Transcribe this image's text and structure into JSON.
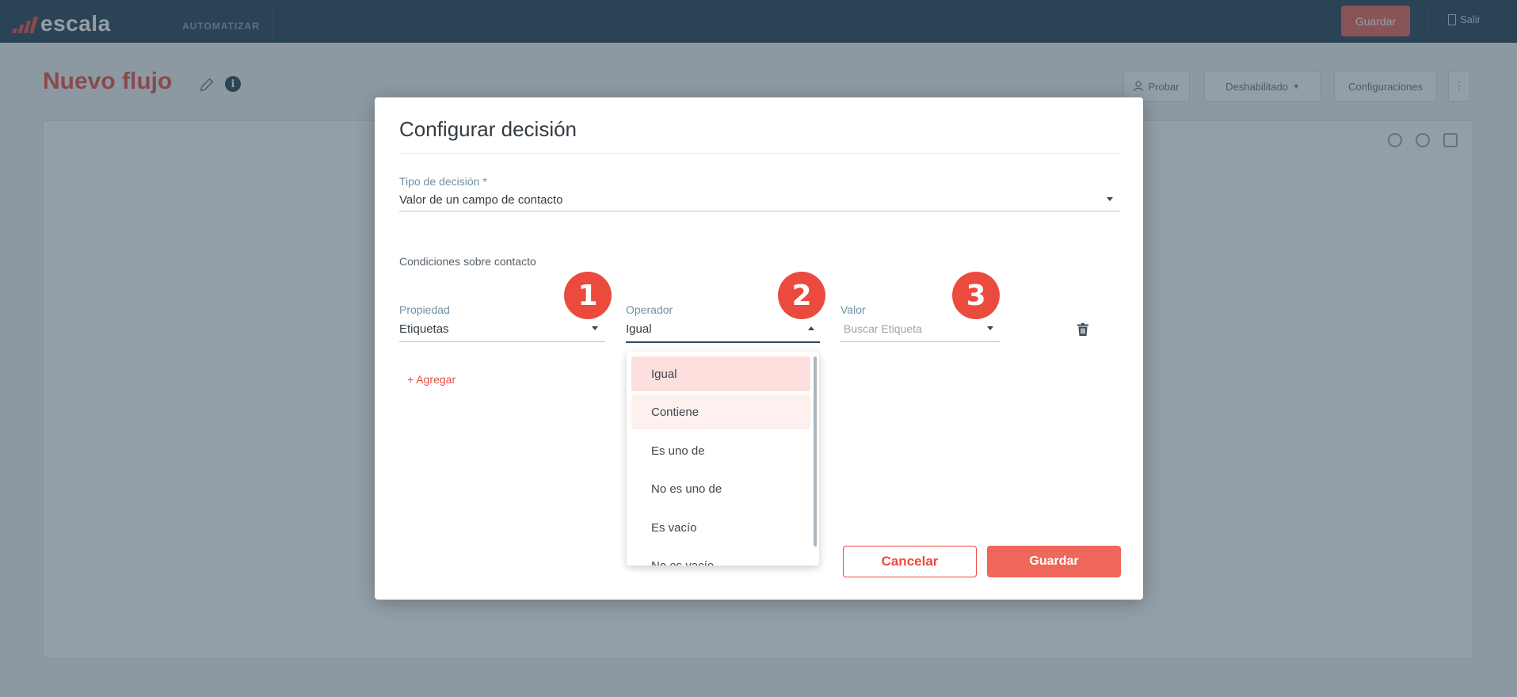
{
  "app": {
    "logo_text": "escala",
    "nav_label": "AUTOMATIZAR",
    "save_label": "Guardar",
    "exit_label": "Salir"
  },
  "page": {
    "title": "Nuevo flujo",
    "toolbar": {
      "test_label": "Probar",
      "status_label": "Deshabilitado",
      "settings_label": "Configuraciones",
      "more_label": "⋮"
    }
  },
  "modal": {
    "title": "Configurar decisión",
    "decision_type": {
      "label": "Tipo de decisión *",
      "value": "Valor de un campo de contacto"
    },
    "conditions_label": "Condiciones sobre contacto",
    "property": {
      "label": "Propiedad",
      "value": "Etiquetas",
      "badge": "1"
    },
    "operator": {
      "label": "Operador",
      "value": "Igual",
      "badge": "2",
      "options": [
        "Igual",
        "Contiene",
        "Es uno de",
        "No es uno de",
        "Es vacío",
        "No es vacío"
      ]
    },
    "valor": {
      "label": "Valor",
      "placeholder": "Buscar Etiqueta",
      "badge": "3"
    },
    "add_label": "+ Agregar",
    "cancel_label": "Cancelar",
    "save_label": "Guardar"
  },
  "colors": {
    "accent": "#ea4b3d",
    "topbar": "#2f4a5d",
    "label": "#6e8fa5"
  }
}
